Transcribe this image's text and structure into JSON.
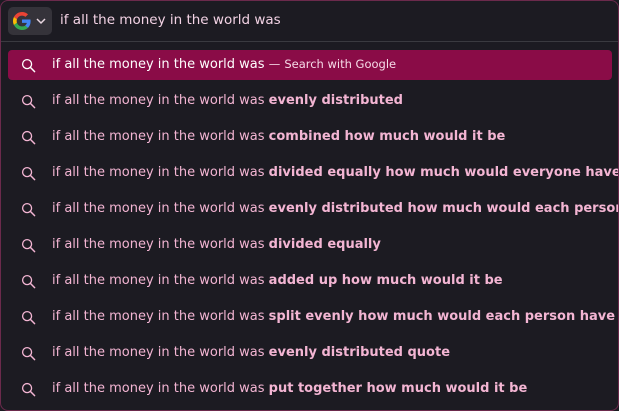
{
  "search_engine": {
    "name": "Google",
    "icon": "google-logo-icon",
    "dropdown_icon": "chevron-down-icon"
  },
  "urlbar": {
    "query": "if all the money in the world was"
  },
  "colors": {
    "background": "#1c1b22",
    "accent": "#8a0c47",
    "suggestion_text": "#f3b5d3",
    "border": "#6b2a4c"
  },
  "first_row": {
    "prefix": "if all the money in the world was",
    "separator": "—",
    "action": "Search with Google"
  },
  "suggestions": [
    {
      "prefix": "if all the money in the world was ",
      "completion": "evenly distributed"
    },
    {
      "prefix": "if all the money in the world was ",
      "completion": "combined how much would it be"
    },
    {
      "prefix": "if all the money in the world was ",
      "completion": "divided equally how much would everyone have"
    },
    {
      "prefix": "if all the money in the world was ",
      "completion": "evenly distributed how much would each person have"
    },
    {
      "prefix": "if all the money in the world was ",
      "completion": "divided equally"
    },
    {
      "prefix": "if all the money in the world was ",
      "completion": "added up how much would it be"
    },
    {
      "prefix": "if all the money in the world was ",
      "completion": "split evenly how much would each person have"
    },
    {
      "prefix": "if all the money in the world was ",
      "completion": "evenly distributed quote"
    },
    {
      "prefix": "if all the money in the world was ",
      "completion": "put together how much would it be"
    }
  ]
}
